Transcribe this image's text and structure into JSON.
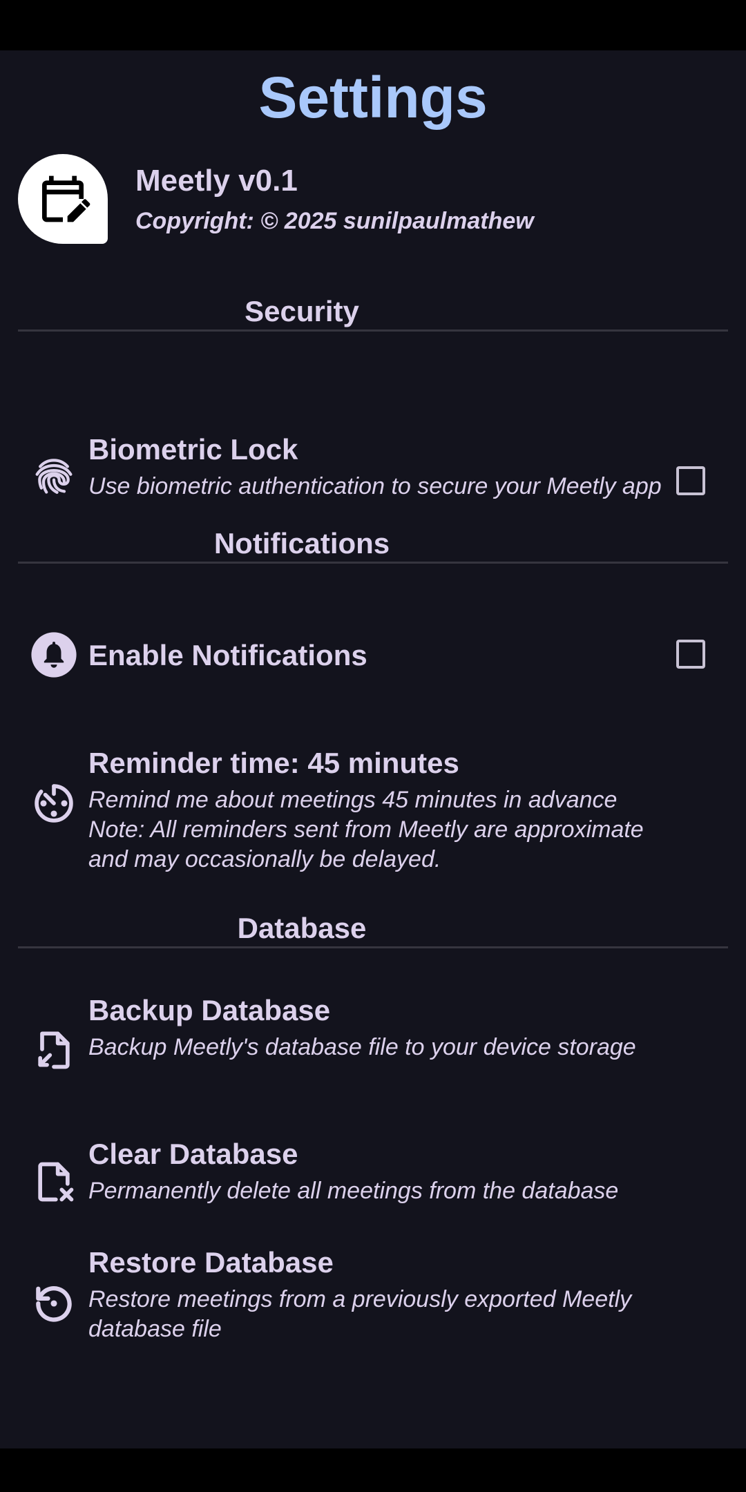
{
  "header": {
    "title": "Settings"
  },
  "app": {
    "name": "Meetly v0.1",
    "copyright": "Copyright: © 2025 sunilpaulmathew",
    "logo_icon": "calendar-edit-icon"
  },
  "sections": {
    "security": "Security",
    "notifications": "Notifications",
    "database": "Database"
  },
  "settings": {
    "biometric": {
      "icon": "fingerprint-icon",
      "title": "Biometric Lock",
      "desc": "Use biometric authentication to secure your Meetly app",
      "checked": false
    },
    "notifications": {
      "icon": "bell-icon",
      "title": "Enable Notifications",
      "checked": false
    },
    "reminder": {
      "icon": "timer-icon",
      "title": "Reminder time: 45 minutes",
      "desc_line1": "Remind me about meetings 45 minutes in advance",
      "desc_line2": "Note: All reminders sent from Meetly are approximate and may occasionally be delayed."
    },
    "backup": {
      "icon": "file-export-icon",
      "title": "Backup Database",
      "desc": "Backup Meetly's database file to your device storage"
    },
    "clear": {
      "icon": "file-delete-icon",
      "title": "Clear Database",
      "desc": "Permanently delete all meetings from the database"
    },
    "restore": {
      "icon": "restore-icon",
      "title": "Restore Database",
      "desc": "Restore meetings from a previously exported Meetly database file"
    }
  },
  "colors": {
    "background": "#13131d",
    "title_accent": "#a9c8fb",
    "text": "#dcd1ec",
    "divider": "#36353f"
  }
}
